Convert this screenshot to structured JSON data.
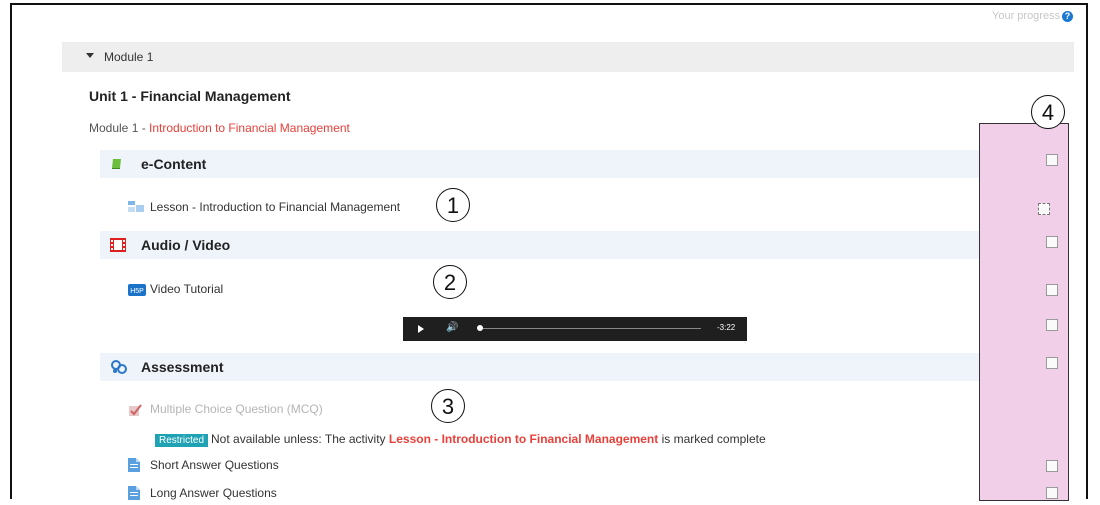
{
  "header": {
    "progress_label": "Your progress",
    "help_icon": "?"
  },
  "module_bar": {
    "label": "Module 1"
  },
  "unit": {
    "title": "Unit 1 - Financial Management"
  },
  "subtitle": {
    "prefix": "Module 1",
    "sep": " - ",
    "highlight": "Introduction to Financial Management"
  },
  "sections": {
    "econtent": {
      "label": "e-Content"
    },
    "audiovideo": {
      "label": "Audio / Video"
    },
    "assessment": {
      "label": "Assessment"
    }
  },
  "activities": {
    "lesson": "Lesson - Introduction to Financial Management",
    "video": "Video Tutorial",
    "mcq": "Multiple Choice Question (MCQ)",
    "short": "Short Answer Questions",
    "long": "Long Answer Questions"
  },
  "player": {
    "time": "-3:22"
  },
  "restriction": {
    "badge": "Restricted",
    "text_before": "Not available unless: The activity ",
    "link": "Lesson - Introduction to Financial Management",
    "text_after": " is marked complete"
  },
  "annotations": {
    "one": "1",
    "two": "2",
    "three": "3",
    "four": "4"
  },
  "colors": {
    "accent_red": "#e8403a",
    "section_bg": "#eef4fa",
    "highlight_pink": "#f2cfe8",
    "badge_teal": "#1fa3b4"
  },
  "icons": {
    "econtent": "book-icon",
    "audiovideo": "film-icon",
    "assessment": "assessment-icon",
    "lesson": "lesson-icon",
    "video": "h5p-icon",
    "mcq": "quiz-icon",
    "short": "assignment-icon",
    "long": "assignment-icon"
  }
}
